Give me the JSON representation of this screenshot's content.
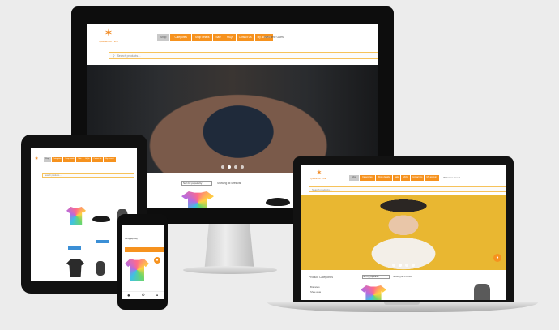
{
  "site": {
    "logo_text": "Quatrainfort TIRE",
    "nav": [
      "Shop",
      "Categories",
      "Shop details",
      "Sale",
      "FAQs",
      "Contact Us",
      "My account"
    ],
    "welcome": "Welcome Guest",
    "search_placeholder": "Search products…",
    "sort_label": "Sort by popularity",
    "showing": "Showing all 4 results",
    "product_categories": "Product Categories",
    "category_item": "Bracelets",
    "category_item2": "Shoe wear"
  },
  "colors": {
    "accent": "#f6921e",
    "nav_home": "#c9c9c9",
    "background": "#ececec"
  },
  "icons": [
    "star-logo-icon",
    "search-icon",
    "cart-icon",
    "user-icon",
    "chevron-down-icon"
  ],
  "slider": {
    "dots": 4,
    "active_dot": 1
  }
}
